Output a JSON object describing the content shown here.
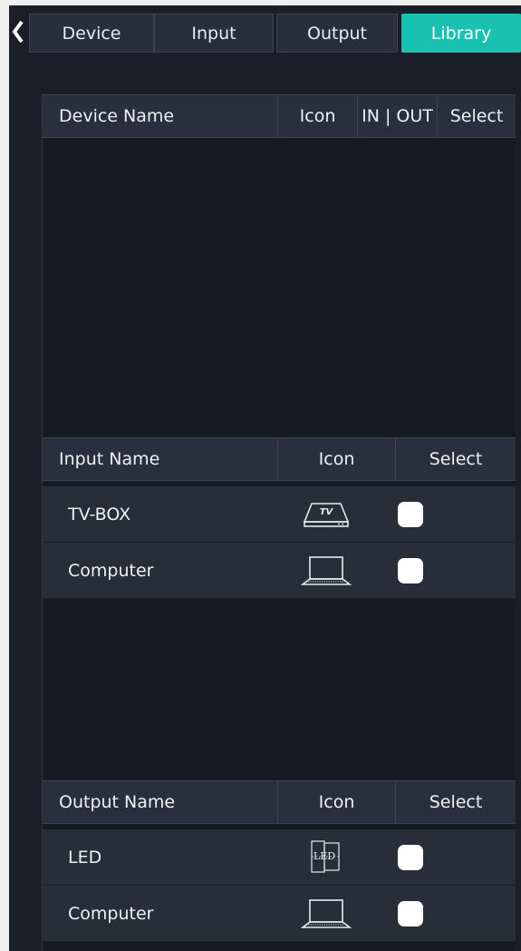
{
  "tabs": {
    "back_icon": "chevron-left-icon",
    "items": [
      {
        "label": "Device"
      },
      {
        "label": "Input"
      },
      {
        "label": "Output"
      },
      {
        "label": "Library",
        "active": true
      }
    ]
  },
  "device_table": {
    "headers": {
      "name": "Device Name",
      "icon": "Icon",
      "io": "IN | OUT",
      "select": "Select"
    },
    "rows": []
  },
  "input_table": {
    "headers": {
      "name": "Input Name",
      "icon": "Icon",
      "select": "Select"
    },
    "rows": [
      {
        "name": "TV-BOX",
        "icon": "tv-box-icon",
        "icon_text": "TV",
        "checked": false
      },
      {
        "name": "Computer",
        "icon": "laptop-icon",
        "checked": false
      }
    ]
  },
  "output_table": {
    "headers": {
      "name": "Output Name",
      "icon": "Icon",
      "select": "Select"
    },
    "rows": [
      {
        "name": "LED",
        "icon": "led-screen-icon",
        "icon_text": "LED",
        "checked": false
      },
      {
        "name": "Computer",
        "icon": "laptop-icon",
        "checked": false
      }
    ]
  },
  "colors": {
    "background": "#1b1d29",
    "accent": "#19c2b0",
    "header": "#2b2e3c",
    "row": "#292c39"
  }
}
